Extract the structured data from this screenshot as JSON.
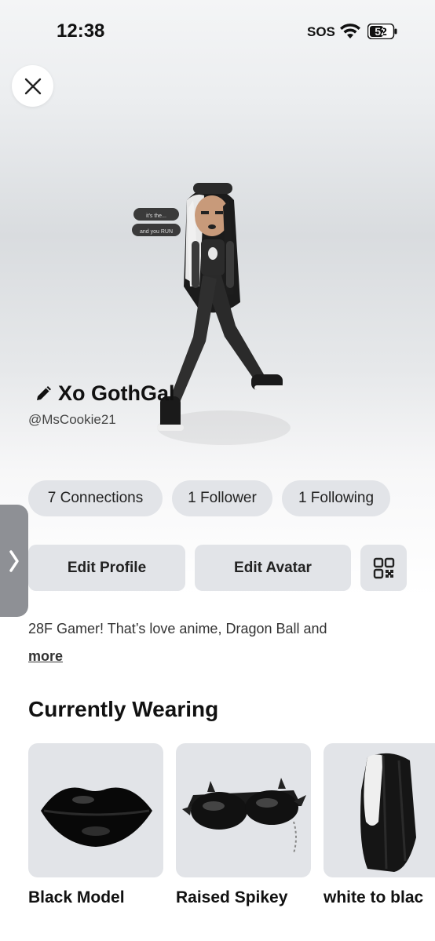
{
  "status_bar": {
    "time": "12:38",
    "sos": "SOS",
    "battery": "52"
  },
  "profile": {
    "display_name": "Xo GothGal",
    "username": "@MsCookie21",
    "bubble_line1": "it's the...",
    "bubble_line2": "and you RUN"
  },
  "stats": [
    {
      "label": "7 Connections"
    },
    {
      "label": "1 Follower"
    },
    {
      "label": "1 Following"
    }
  ],
  "actions": {
    "edit_profile": "Edit Profile",
    "edit_avatar": "Edit Avatar"
  },
  "bio": {
    "text": "28F Gamer! That’s love anime, Dragon Ball and",
    "more": "more"
  },
  "wearing": {
    "title": "Currently Wearing",
    "items": [
      {
        "name": "Black Model"
      },
      {
        "name": "Raised Spikey"
      },
      {
        "name": "white to blac"
      }
    ]
  },
  "icons": {
    "close": "close-icon",
    "edit": "pencil-icon",
    "qr": "qr-code-icon",
    "side_tab": "chevron-right-icon",
    "wifi": "wifi-icon",
    "battery": "battery-icon"
  }
}
